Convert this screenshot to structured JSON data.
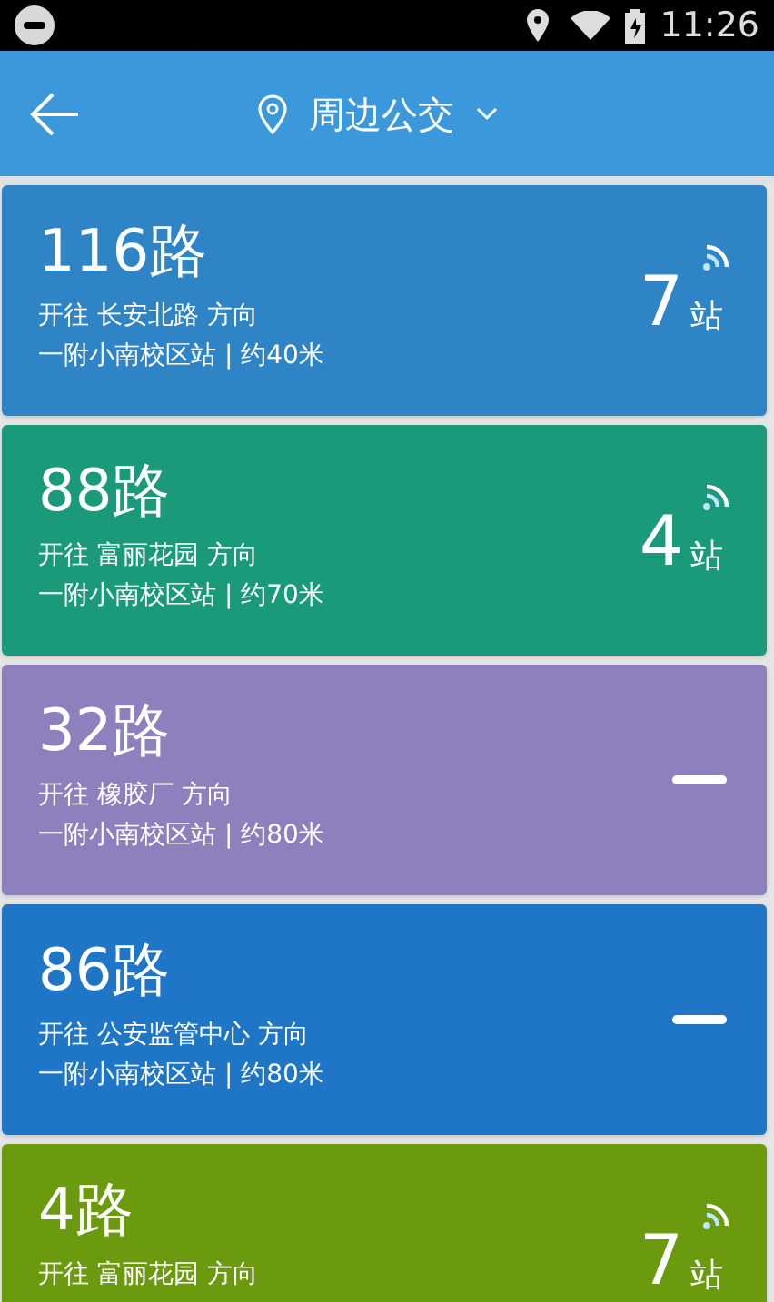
{
  "status_bar": {
    "time": "11:26"
  },
  "header": {
    "title": "周边公交"
  },
  "routes": [
    {
      "name": "116路",
      "direction": "开往 长安北路 方向",
      "stop": "一附小南校区站 | 约40米",
      "color": "#2f84c6",
      "kind": "realtime",
      "count": "7",
      "unit": "站"
    },
    {
      "name": "88路",
      "direction": "开往 富丽花园 方向",
      "stop": "一附小南校区站 | 约70米",
      "color": "#1b9a7b",
      "kind": "realtime",
      "count": "4",
      "unit": "站"
    },
    {
      "name": "32路",
      "direction": "开往 橡胶厂 方向",
      "stop": "一附小南校区站 | 约80米",
      "color": "#8d80bc",
      "kind": "none"
    },
    {
      "name": "86路",
      "direction": "开往 公安监管中心 方向",
      "stop": "一附小南校区站 | 约80米",
      "color": "#1f76c6",
      "kind": "none"
    },
    {
      "name": "4路",
      "direction": "开往 富丽花园 方向",
      "color": "#6b9a0f",
      "kind": "realtime",
      "count": "7",
      "unit": "站"
    }
  ]
}
